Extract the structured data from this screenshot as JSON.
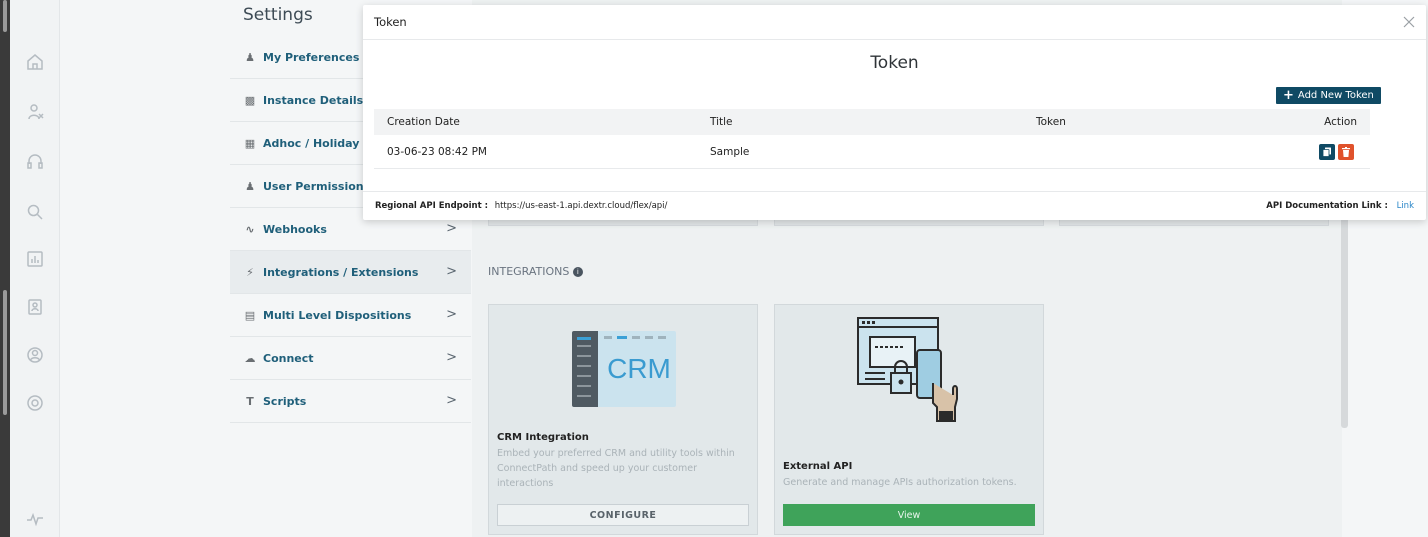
{
  "settings": {
    "title": "Settings",
    "menu": [
      {
        "label": "My Preferences",
        "icon": "user-icon"
      },
      {
        "label": "Instance Details",
        "icon": "building-icon"
      },
      {
        "label": "Adhoc / Holiday Clo",
        "icon": "calendar-icon"
      },
      {
        "label": "User Permissions",
        "icon": "user-lock-icon"
      },
      {
        "label": "Webhooks",
        "icon": "webhook-icon"
      },
      {
        "label": "Integrations / Extensions",
        "icon": "plug-icon"
      },
      {
        "label": "Multi Level Dispositions",
        "icon": "list-icon"
      },
      {
        "label": "Connect",
        "icon": "cloud-icon"
      },
      {
        "label": "Scripts",
        "icon": "text-icon"
      }
    ],
    "chevron": ">"
  },
  "main": {
    "integrations_title": "INTEGRATIONS",
    "cards": [
      {
        "title": "CRM Integration",
        "desc": "Embed your preferred CRM and utility tools within ConnectPath and speed up your customer interactions",
        "button": "CONFIGURE",
        "image_label": "CRM"
      },
      {
        "title": "External API",
        "desc": "Generate and manage APIs authorization tokens.",
        "button": "View"
      }
    ]
  },
  "modal": {
    "header_title": "Token",
    "heading": "Token",
    "add_button": "Add New Token",
    "columns": [
      "Creation Date",
      "Title",
      "Token",
      "Action"
    ],
    "rows": [
      {
        "creation_date": "03-06-23 08:42 PM",
        "title": "Sample",
        "token": ""
      }
    ],
    "footer": {
      "endpoint_label": "Regional API Endpoint :",
      "endpoint_url": "https://us-east-1.api.dextr.cloud/flex/api/",
      "doc_label": "API Documentation Link :",
      "doc_link": "Link"
    }
  },
  "colors": {
    "primary": "#0f4a64",
    "danger": "#e0522c",
    "success": "#3fa35a",
    "link": "#2a86c8"
  }
}
